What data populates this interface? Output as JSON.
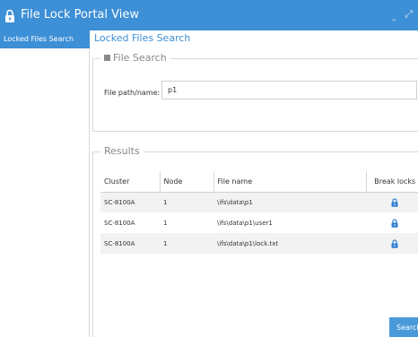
{
  "window": {
    "title": "File Lock Portal View",
    "title_icon": "lock-icon",
    "controls": {
      "minimize": "–",
      "maximize": "⤢"
    }
  },
  "sidebar": {
    "items": [
      {
        "label": "Locked Files Search",
        "selected": true
      }
    ]
  },
  "main": {
    "title": "Locked Files Search",
    "file_search": {
      "legend": "File Search",
      "field_label": "File path/name:",
      "field_value": "p1"
    },
    "results": {
      "legend": "Results",
      "columns": [
        "Cluster",
        "Node",
        "File name",
        "Break locks"
      ],
      "rows": [
        {
          "cluster": "SC-8100A",
          "node": "1",
          "file": "\\ifs\\data\\p1",
          "icon": "unlock-icon"
        },
        {
          "cluster": "SC-8100A",
          "node": "1",
          "file": "\\ifs\\data\\p1\\user1",
          "icon": "unlock-icon"
        },
        {
          "cluster": "SC-8100A",
          "node": "1",
          "file": "\\ifs\\data\\p1\\lock.txt",
          "icon": "unlock-icon"
        }
      ]
    },
    "search_button": "Search"
  },
  "colors": {
    "accent": "#3d8fd6",
    "row_stripe": "#f2f2f2",
    "lock_icon": "#2f7fd0"
  }
}
